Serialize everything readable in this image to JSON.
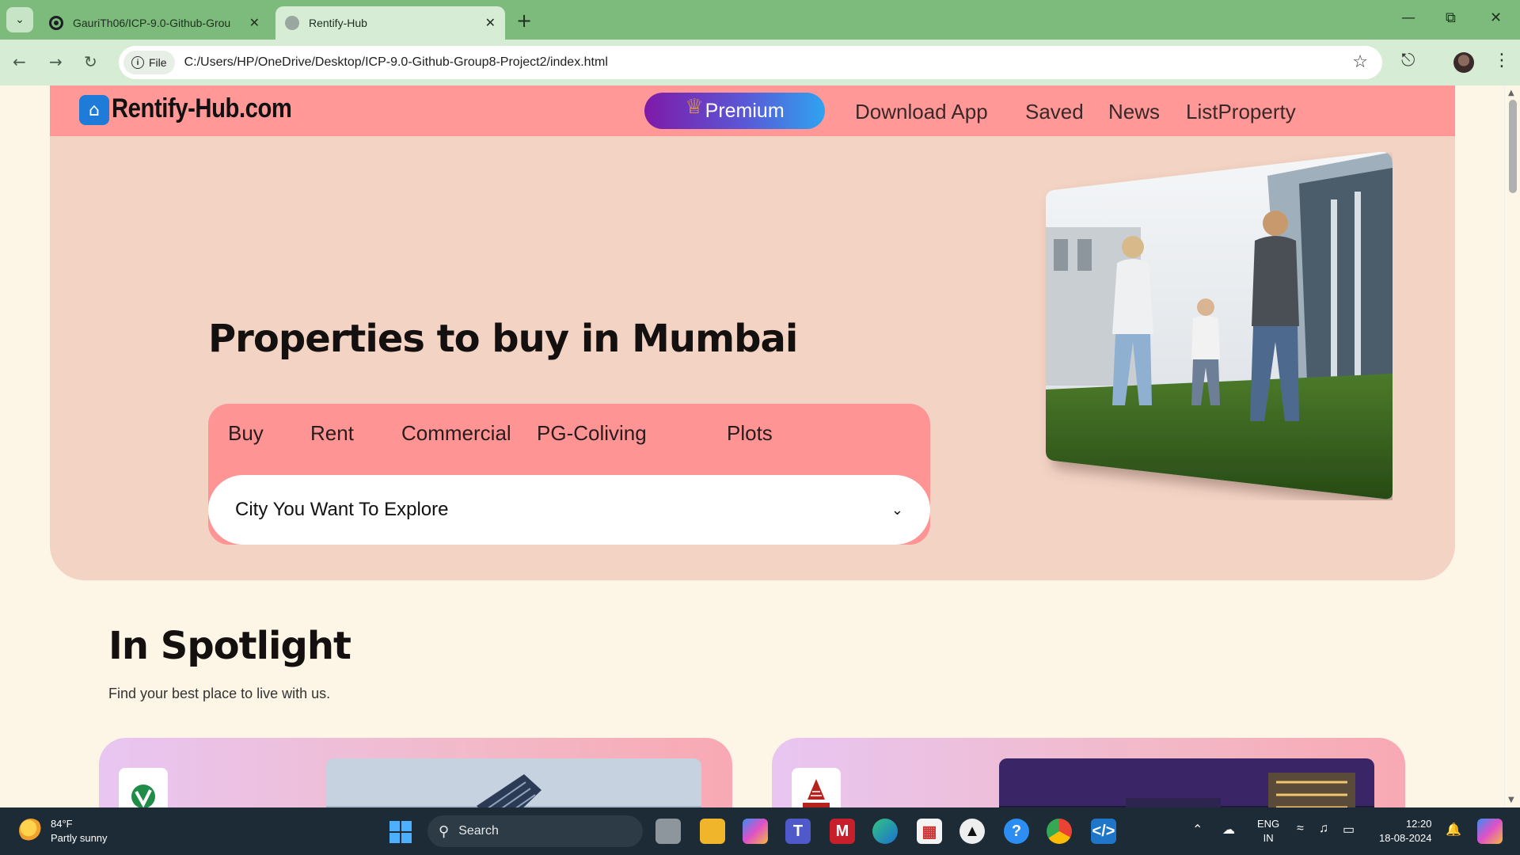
{
  "browser": {
    "tabs": [
      {
        "title": "GauriTh06/ICP-9.0-Github-Grou",
        "active": false
      },
      {
        "title": "Rentify-Hub",
        "active": true
      }
    ],
    "address": {
      "chip_label": "File",
      "url": "C:/Users/HP/OneDrive/Desktop/ICP-9.0-Github-Group8-Project2/index.html"
    }
  },
  "site": {
    "logo_text": "Rentify-Hub.com",
    "premium_label": "Premium",
    "nav": [
      {
        "label": "Download App"
      },
      {
        "label": "Saved"
      },
      {
        "label": "News"
      },
      {
        "label": "ListProperty"
      }
    ],
    "hero_title": "Properties to buy in Mumbai",
    "search_tabs": [
      {
        "label": "Buy"
      },
      {
        "label": "Rent"
      },
      {
        "label": "Commercial"
      },
      {
        "label": "PG-Coliving"
      },
      {
        "label": "Plots"
      }
    ],
    "city_select": {
      "selected": "City You Want To Explore"
    },
    "spotlight": {
      "title": "In Spotlight",
      "subtitle": "Find your best place to live with us."
    },
    "colors": {
      "nav_bg": "#ff9896",
      "hero_bg": "#f3d3c4",
      "search_bg": "#ff9494",
      "page_bg": "#fdf6e7"
    }
  },
  "taskbar": {
    "weather_temp": "84°F",
    "weather_desc": "Partly sunny",
    "search_label": "Search",
    "lang_line1": "ENG",
    "lang_line2": "IN",
    "time": "12:20",
    "date": "18-08-2024"
  }
}
